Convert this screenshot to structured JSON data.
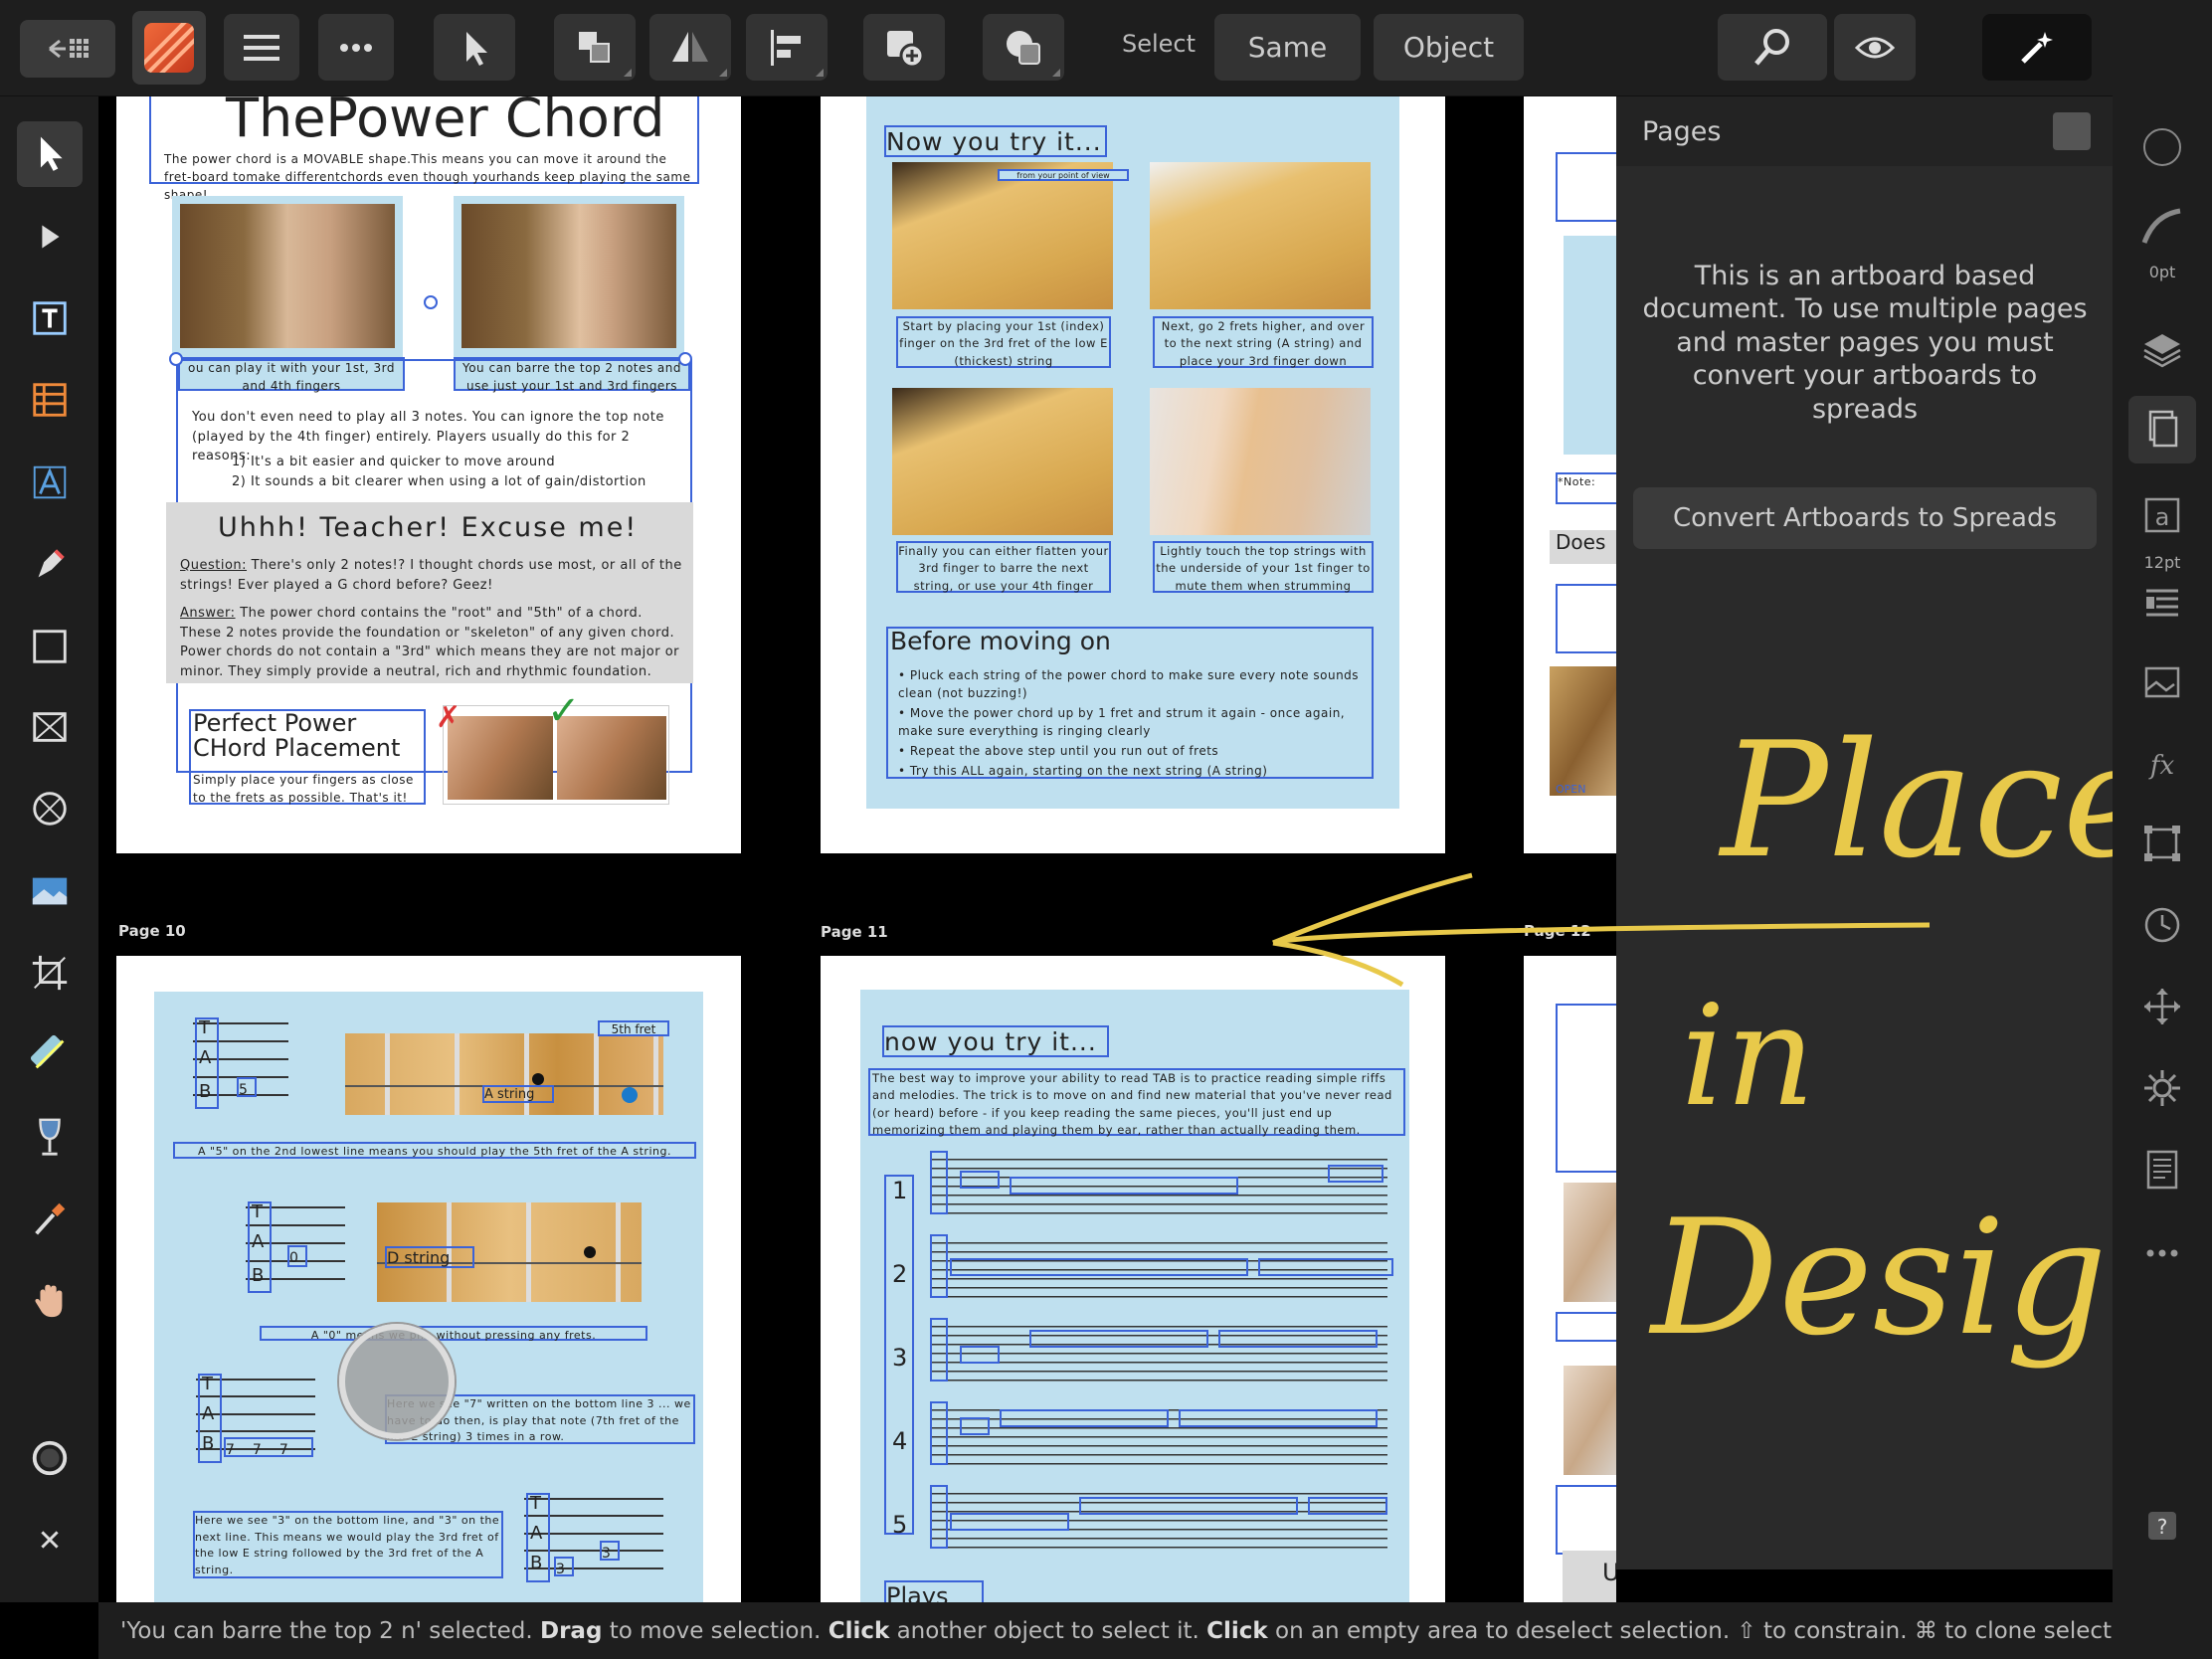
{
  "toolbar": {
    "select_label": "Select",
    "same_label": "Same",
    "object_label": "Object"
  },
  "panel": {
    "title": "Pages",
    "message": "This is an artboard based document. To use multiple pages and master pages you must convert your artboards to spreads",
    "convert_label": "Convert Artboards to Spreads"
  },
  "right_strip": {
    "stroke_width": "0pt",
    "font_size": "12pt"
  },
  "pages": {
    "labels": [
      "Page 10",
      "Page 11",
      "Page 12"
    ],
    "p9": {
      "title": "ThePower Chord",
      "intro": "The power chord is a MOVABLE shape.This means you can move it around the fret-board tomake differentchords even though yourhands keep playing the same shape!",
      "cap1": "ou can play it with your 1st, 3rd and 4th fingers",
      "cap2": "You can barre the top 2 notes and use just your 1st and 3rd fingers",
      "body": "You don't even need to play all 3 notes. You can ignore the top note (played by the 4th finger) entirely. Players usually do this for 2 reasons:",
      "reason1": "1) It's a bit easier and quicker to move around",
      "reason2": "2) It sounds a bit clearer when using a lot of gain/distortion",
      "teacher": "Uhhh! Teacher! Excuse me!",
      "question_label": "Question:",
      "question": "There's only 2 notes!? I thought chords use most, or all of the strings! Ever played a G chord before? Geez!",
      "answer_label": "Answer:",
      "answer": "The power chord contains the \"root\" and \"5th\" of a chord. These 2 notes provide the foundation or \"skeleton\" of any given chord. Power chords do not contain a \"3rd\" which means they are not major or minor. They simply provide a neutral, rich and rhythmic foundation.",
      "placement_title": "Perfect Power CHord Placement",
      "placement_body": "Simply place your fingers as close to the frets as possible. That's it!"
    },
    "p10": {
      "title": "Now you try it...",
      "pov": "from your point of view",
      "c1": "Start by placing your 1st (index) finger on the 3rd fret of the low E (thickest) string",
      "c2": "Next, go 2 frets higher, and over to the next string (A string) and place your 3rd finger down",
      "c3": "Finally you can either flatten your 3rd finger to barre the next string, or use your 4th finger",
      "c4": "Lightly touch the top strings with the underside of your 1st finger to mute them when strumming",
      "before_title": "Before moving on",
      "b1": "Pluck each string of the power chord to make sure every note sounds clean (not buzzing!)",
      "b2": "Move the power chord up by 1 fret and strum it again - once again, make sure everything is ringing clearly",
      "b3": "Repeat the above step until you run out of frets",
      "b4": "Try this ALL again, starting on the next string (A string)"
    },
    "p12": {
      "fret5": "5th fret",
      "astring": "A string",
      "line1": "A \"5\" on the 2nd lowest line means you should play the 5th fret of the A string.",
      "dstring": "D string",
      "line2": "A \"0\" means we pl... without pressing any frets.",
      "line3": "Here we see \"7\" written on the bottom line 3 ... we have to do then, is play that note (7th fret of the low E string) 3 times in a row.",
      "line4": "Here we see \"3\" on the bottom line, and \"3\" on the next line. This means we would play the 3rd fret of the low E string followed by the 3rd fret of the A string."
    },
    "p11": {
      "title": "now you try it...",
      "intro": "The best way to improve your ability to read TAB is to practice reading simple riffs and melodies. The trick is to move on and find new material that you've never read (or heard) before - if you keep reading the same pieces, you'll just end up memorizing them and playing them by ear, rather than actually reading them.",
      "rows": [
        "1",
        "2",
        "3",
        "4",
        "5"
      ],
      "plays": "Plays"
    },
    "p13": {
      "teacher": "Uhhh! Teacher! Excuse me!",
      "note": "*Note:",
      "does": "Does",
      "open": "OPEN"
    }
  },
  "handwriting": {
    "words": [
      "Placed",
      "in",
      "Designer"
    ],
    "color": "#e8c94a"
  },
  "status": {
    "selected": "'You can barre the top 2 n' selected.",
    "drag": "Drag",
    "drag_text": "to move selection.",
    "click": "Click",
    "click_text": "another object to select it.",
    "click2": "Click",
    "click2_text": "on an empty area to deselect selection. ⇧ to constrain. ⌘ to clone selected o"
  },
  "colors": {
    "accent": "#3b63d8",
    "panel": "#2a2a2a",
    "page_blue": "#bfe0ef",
    "app_icon": "#e0522b"
  }
}
